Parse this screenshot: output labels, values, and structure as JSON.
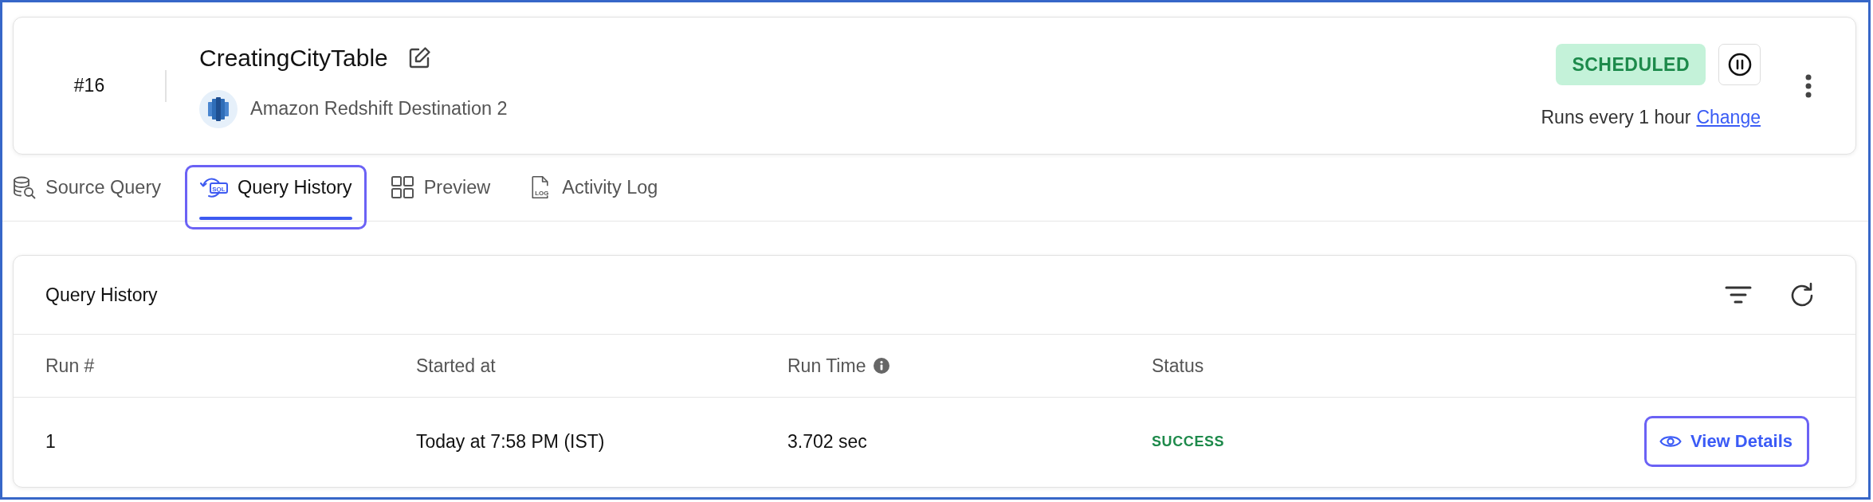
{
  "header": {
    "number": "#16",
    "title": "CreatingCityTable",
    "destination": "Amazon Redshift Destination 2",
    "status": "SCHEDULED",
    "schedule": "Runs every 1 hour",
    "schedule_link": "Change"
  },
  "tabs": [
    {
      "kind": "source",
      "label": "Source Query",
      "selected": false,
      "focused": false
    },
    {
      "kind": "history",
      "label": "Query History",
      "icon_text": "SQL",
      "selected": true,
      "focused": true
    },
    {
      "kind": "preview",
      "label": "Preview",
      "selected": false,
      "focused": false
    },
    {
      "kind": "log",
      "label": "Activity Log",
      "icon_text": "LOG",
      "selected": false,
      "focused": false
    }
  ],
  "history": {
    "title": "Query History",
    "columns": [
      {
        "kind": "plain",
        "label": "Run #"
      },
      {
        "kind": "plain",
        "label": "Started at"
      },
      {
        "kind": "info",
        "label": "Run Time"
      },
      {
        "kind": "plain",
        "label": "Status"
      }
    ],
    "rows": [
      {
        "run": "1",
        "started_at": "Today at 7:58 PM (IST)",
        "run_time": "3.702 sec",
        "status": "SUCCESS",
        "action": "View Details",
        "action_focused": true
      }
    ]
  }
}
